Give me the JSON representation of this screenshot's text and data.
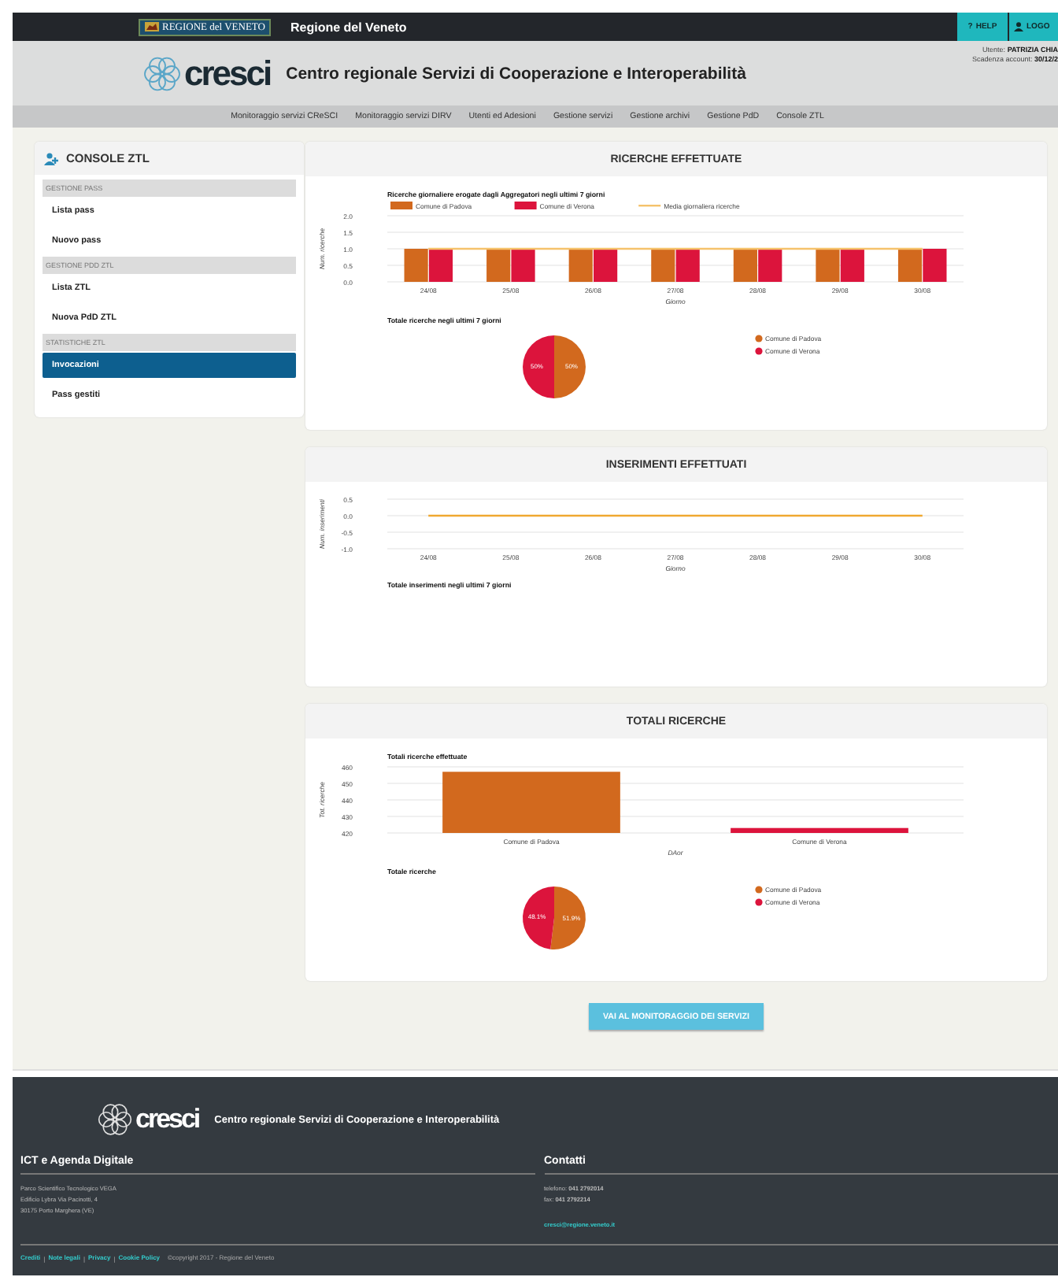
{
  "topbar": {
    "region_logo": "REGIONE del VENETO",
    "title": "Regione del Veneto",
    "buttons": [
      {
        "kind": "help",
        "icon": "?",
        "label": "HELP"
      },
      {
        "kind": "user",
        "label": "LOGO"
      }
    ]
  },
  "header": {
    "logo": "cresci",
    "title": "Centro regionale Servizi di Cooperazione e Interoperabilità",
    "user_label": "Utente:",
    "user": "PATRIZIA CHIA",
    "expiry_label": "Scadenza account:",
    "expiry": "30/12/2"
  },
  "nav": [
    "Monitoraggio servizi CReSCI",
    "Monitoraggio servizi DIRV",
    "Utenti ed Adesioni",
    "Gestione servizi",
    "Gestione archivi",
    "Gestione PdD",
    "Console ZTL"
  ],
  "sidebar": {
    "title": "CONSOLE ZTL",
    "items": [
      {
        "kind": "section",
        "label": "GESTIONE PASS"
      },
      {
        "kind": "link",
        "label": "Lista pass",
        "selected": false
      },
      {
        "kind": "link",
        "label": "Nuovo pass",
        "selected": false
      },
      {
        "kind": "section",
        "label": "GESTIONE PDD ZTL"
      },
      {
        "kind": "link",
        "label": "Lista ZTL",
        "selected": false
      },
      {
        "kind": "link",
        "label": "Nuova PdD ZTL",
        "selected": false
      },
      {
        "kind": "section",
        "label": "STATISTICHE ZTL"
      },
      {
        "kind": "link",
        "label": "Invocazioni",
        "selected": true
      },
      {
        "kind": "link",
        "label": "Pass gestiti",
        "selected": false
      }
    ]
  },
  "panels": [
    {
      "title": "RICERCHE EFFETTUATE",
      "charts": [
        {
          "chart_data": {
            "type": "bar",
            "title": "Ricerche giornaliere erogate dagli Aggregatori negli ultimi 7 giorni",
            "xlabel": "Giorno",
            "ylabel": "Num. ricerche",
            "categories": [
              "24/08",
              "25/08",
              "26/08",
              "27/08",
              "28/08",
              "29/08",
              "30/08"
            ],
            "ylim": [
              0,
              2
            ],
            "yticks": [
              {
                "value": 0,
                "label": "0.0"
              },
              {
                "value": 0.5,
                "label": "0.5"
              },
              {
                "value": 1,
                "label": "1.0"
              },
              {
                "value": 1.5,
                "label": "1.5"
              },
              {
                "value": 2,
                "label": "2.0"
              }
            ],
            "legend": "top",
            "series": [
              {
                "name": "Comune di Padova",
                "type": "bar",
                "color": "#d2691e",
                "values": [
                  1,
                  1,
                  1,
                  1,
                  1,
                  1,
                  1
                ]
              },
              {
                "name": "Comune di Verona",
                "type": "bar",
                "color": "#dc143c",
                "values": [
                  1,
                  1,
                  1,
                  1,
                  1,
                  1,
                  1
                ]
              },
              {
                "name": "Media giornaliera ricerche",
                "type": "line",
                "color": "#f5c26b",
                "values": [
                  1,
                  1,
                  1,
                  1,
                  1,
                  1,
                  1
                ]
              }
            ],
            "grid": true
          }
        },
        {
          "chart_data": {
            "type": "pie",
            "title": "Totale ricerche negli ultimi 7 giorni",
            "categories": [
              "Comune di Padova",
              "Comune di Verona"
            ],
            "values": [
              50,
              50
            ],
            "value_labels": [
              "50%",
              "50%"
            ],
            "legend": "right"
          }
        }
      ]
    },
    {
      "title": "INSERIMENTI EFFETTUATI",
      "charts": [
        {
          "chart_data": {
            "type": "line",
            "xlabel": "Giorno",
            "ylabel": "Num. inserimenti",
            "categories": [
              "24/08",
              "25/08",
              "26/08",
              "27/08",
              "28/08",
              "29/08",
              "30/08"
            ],
            "ylim": [
              -1,
              0.5
            ],
            "yticks": [
              {
                "value": -1,
                "label": "-1.0"
              },
              {
                "value": -0.5,
                "label": "-0.5"
              },
              {
                "value": 0,
                "label": "0.0"
              },
              {
                "value": 0.5,
                "label": "0.5"
              }
            ],
            "series": [
              {
                "type": "line",
                "color": "#f0a830",
                "values": [
                  0,
                  0,
                  0,
                  0,
                  0,
                  0,
                  0
                ]
              }
            ],
            "grid": true
          }
        }
      ],
      "note": "Totale inserimenti negli ultimi 7 giorni"
    },
    {
      "title": "TOTALI RICERCHE",
      "charts": [
        {
          "chart_data": {
            "type": "bar",
            "title": "Totali ricerche effettuate",
            "xlabel": "DAor",
            "ylabel": "Tot. ricerche",
            "categories": [
              "Comune di Padova",
              "Comune di Verona"
            ],
            "ylim": [
              420,
              460
            ],
            "yticks": [
              420,
              430,
              440,
              450,
              460
            ],
            "series": [
              {
                "type": "bar",
                "color": "#d2691e",
                "values": [
                  457,
                  null
                ]
              },
              {
                "type": "bar",
                "color": "#dc143c",
                "values": [
                  null,
                  423
                ]
              }
            ],
            "grid": true
          }
        },
        {
          "chart_data": {
            "type": "pie",
            "title": "Totale ricerche",
            "categories": [
              "Comune di Padova",
              "Comune di Verona"
            ],
            "values": [
              51.9,
              48.1
            ],
            "value_labels": [
              "51.9%",
              "48.1%"
            ],
            "legend": "right"
          }
        }
      ]
    }
  ],
  "action_button": "VAI AL MONITORAGGIO DEI SERVIZI",
  "footer": {
    "logo": "cresci",
    "title": "Centro regionale Servizi di Cooperazione e Interoperabilità",
    "columns": [
      {
        "heading": "ICT e Agenda Digitale",
        "lines": [
          "Parco Scientifico Tecnologico VEGA",
          "Edificio Lybra Via Pacinotti, 4",
          "30175 Porto Marghera (VE)"
        ]
      },
      {
        "heading": "Contatti",
        "lines": [
          "telefono: **041 2792014**",
          "fax: **041 2792214**"
        ],
        "email": "cresci@regione.veneto.it"
      }
    ],
    "links": [
      "Crediti",
      "Note legali",
      "Privacy",
      "Cookie Policy"
    ],
    "separator": "|",
    "copyright": "©copyright 2017 - Regione del Veneto"
  }
}
